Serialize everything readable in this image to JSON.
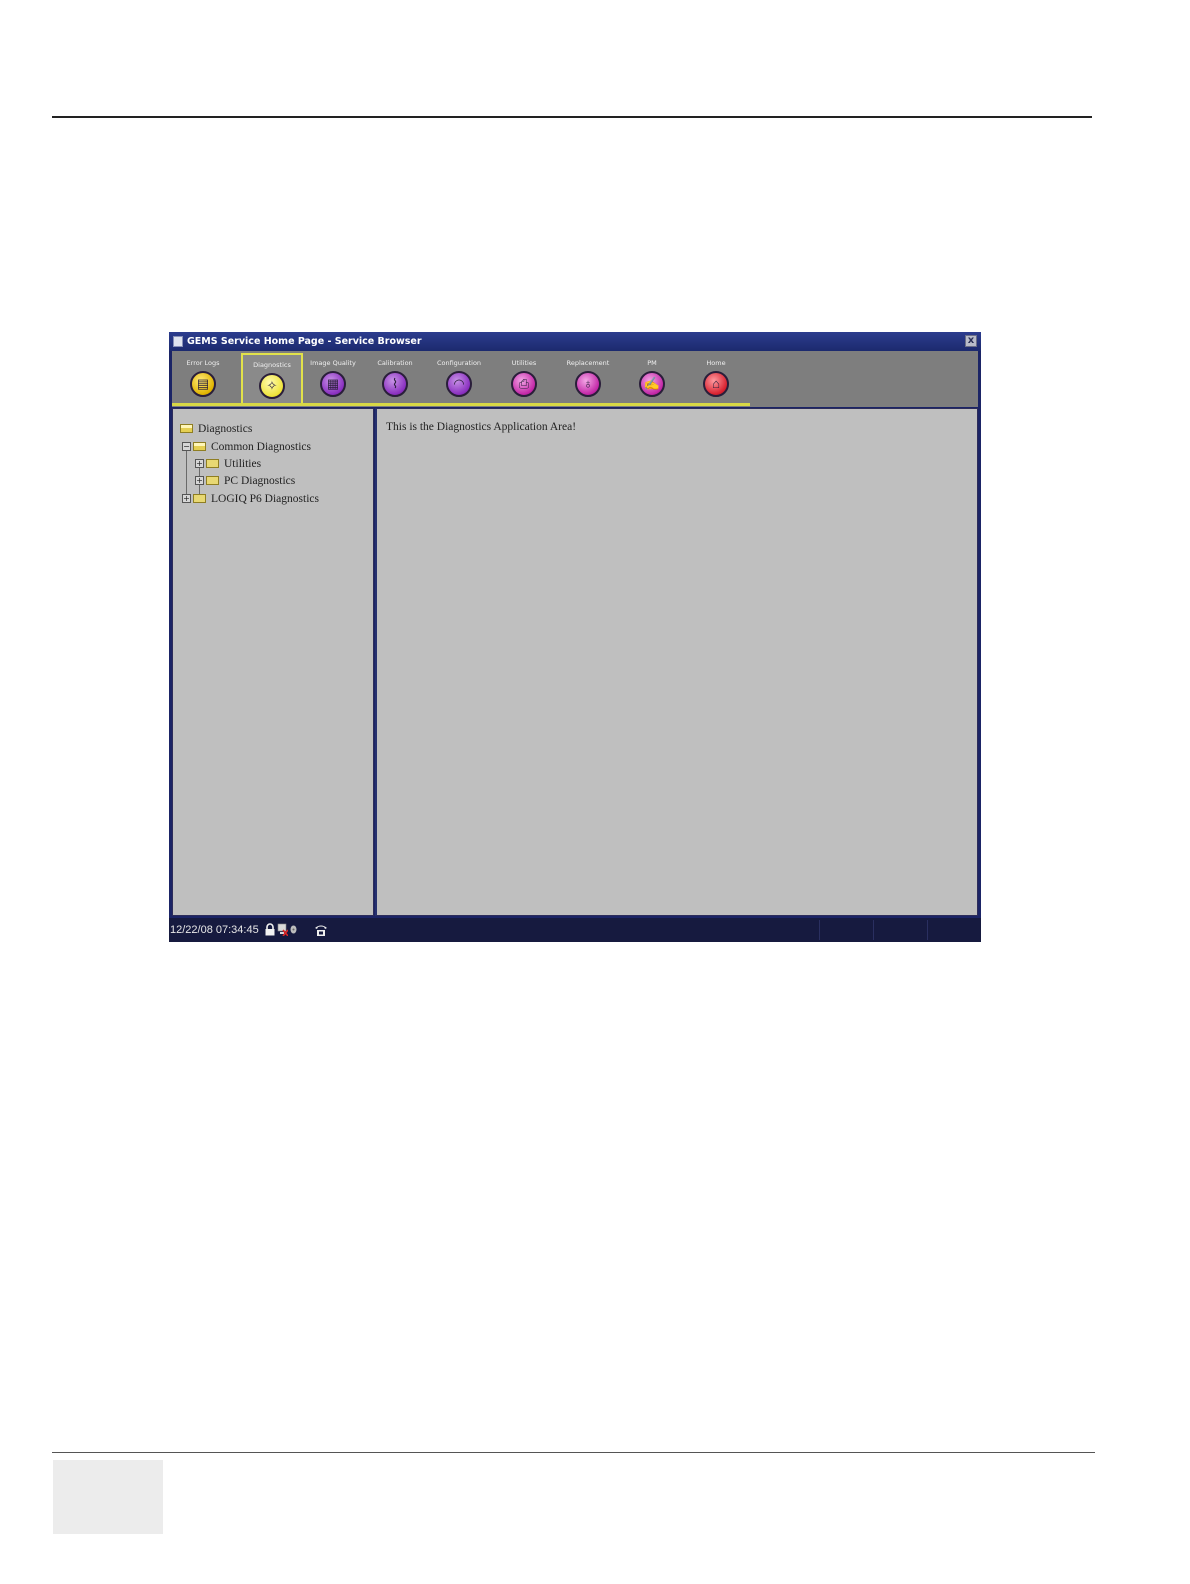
{
  "window": {
    "title": "GEMS Service Home Page - Service Browser",
    "close_label": "x"
  },
  "tabs": [
    {
      "label": "Error Logs",
      "icon": "error-logs-icon",
      "color": "#e0b300",
      "glyph": "▤"
    },
    {
      "label": "Diagnostics",
      "icon": "diagnostics-icon",
      "color": "#efe33a",
      "glyph": "✧",
      "active": true
    },
    {
      "label": "Image Quality",
      "icon": "image-quality-icon",
      "color": "#8a2fc0",
      "glyph": "▦"
    },
    {
      "label": "Calibration",
      "icon": "calibration-icon",
      "color": "#8a2fc0",
      "glyph": "⌇"
    },
    {
      "label": "Configuration",
      "icon": "configuration-icon",
      "color": "#8a2fc0",
      "glyph": "◠"
    },
    {
      "label": "Utilities",
      "icon": "utilities-icon",
      "color": "#c327a7",
      "glyph": "⎙"
    },
    {
      "label": "Replacement",
      "icon": "replacement-icon",
      "color": "#c327a7",
      "glyph": "♁"
    },
    {
      "label": "PM",
      "icon": "pm-icon",
      "color": "#c327a7",
      "glyph": "✍"
    },
    {
      "label": "Home",
      "icon": "home-icon",
      "color": "#d8202e",
      "glyph": "⌂"
    }
  ],
  "tree": {
    "root": "Diagnostics",
    "common": "Common Diagnostics",
    "utilities": "Utilities",
    "pc": "PC Diagnostics",
    "logiq": "LOGIQ P6 Diagnostics"
  },
  "main": {
    "text": "This is the Diagnostics Application Area!"
  },
  "status": {
    "datetime": "12/22/08 07:34:45"
  }
}
